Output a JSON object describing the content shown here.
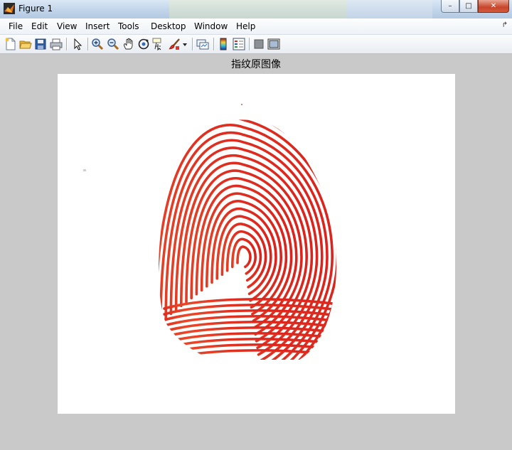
{
  "window": {
    "title": "Figure 1",
    "controls": {
      "minimize": "–",
      "maximize": "□",
      "close": "✕"
    }
  },
  "menu": {
    "items": [
      "File",
      "Edit",
      "View",
      "Insert",
      "Tools",
      "Desktop",
      "Window",
      "Help"
    ]
  },
  "toolbar": {
    "icons": [
      "new-figure-icon",
      "open-file-icon",
      "save-icon",
      "print-icon",
      "edit-plot-arrow-icon",
      "zoom-in-icon",
      "zoom-out-icon",
      "pan-hand-icon",
      "rotate-3d-icon",
      "data-cursor-icon",
      "brush-icon",
      "brush-dropdown-icon",
      "link-plot-icon",
      "colorbar-icon",
      "legend-icon",
      "hide-plot-tools-icon",
      "show-plot-tools-icon"
    ]
  },
  "figure": {
    "axes_title": "指纹原图像",
    "fingerprint_color": "#e03a26"
  },
  "colors": {
    "figure_bg": "#c9c9c9",
    "axes_bg": "#ffffff"
  }
}
